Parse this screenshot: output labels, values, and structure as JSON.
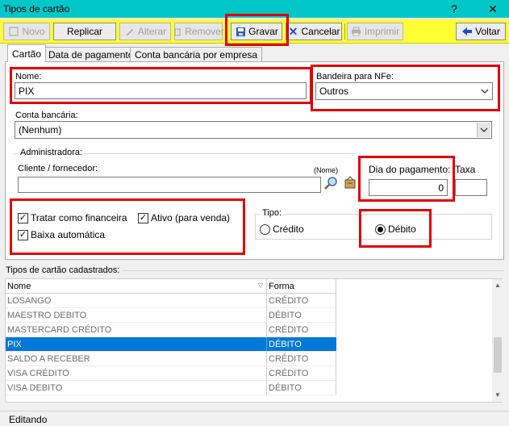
{
  "window": {
    "title": "Tipos de cartão",
    "help": "?",
    "close": "✕"
  },
  "toolbar": {
    "novo": "Novo",
    "replicar": "Replicar",
    "alterar": "Alterar",
    "remover": "Remover",
    "gravar": "Gravar",
    "cancelar": "Cancelar",
    "imprimir": "Imprimir",
    "voltar": "Voltar"
  },
  "tabs": [
    "Cartão",
    "Data de pagamento",
    "Conta bancária por empresa"
  ],
  "form": {
    "nome_label": "Nome:",
    "nome_value": "PIX",
    "bandeira_label": "Bandeira para NFe:",
    "bandeira_value": "Outros",
    "conta_label": "Conta bancária:",
    "conta_value": "(Nenhum)",
    "administradora_title": "Administradora:",
    "cliente_label": "Cliente / fornecedor:",
    "cliente_value": "",
    "nome_hint": "(Nome)",
    "dia_label": "Dia do pagamento:",
    "dia_value": "0",
    "taxa_label": "Taxa",
    "taxa_value": "",
    "tratar_label": "Tratar como financeira",
    "ativo_label": "Ativo (para venda)",
    "baixa_label": "Baixa automática",
    "tipo_title": "Tipo:",
    "credito_label": "Crédito",
    "debito_label": "Débito"
  },
  "list": {
    "section_title": "Tipos de cartão cadastrados:",
    "col_nome": "Nome",
    "col_forma": "Forma",
    "rows": [
      {
        "nome": "LOSANGO",
        "forma": "CRÉDITO"
      },
      {
        "nome": "MAESTRO DEBITO",
        "forma": "DÉBITO"
      },
      {
        "nome": "MASTERCARD CRÉDITO",
        "forma": "CRÉDITO"
      },
      {
        "nome": "PIX",
        "forma": "DÉBITO"
      },
      {
        "nome": "SALDO A RECEBER",
        "forma": "CRÉDITO"
      },
      {
        "nome": "VISA CRÉDITO",
        "forma": "CRÉDITO"
      },
      {
        "nome": "VISA DEBITO",
        "forma": "DÉBITO"
      }
    ]
  },
  "status": {
    "text": "Editando"
  },
  "colors": {
    "titlebar": "#00c8c8",
    "toolbar": "#ffff33",
    "selection": "#0078d7",
    "highlight": "#e00000"
  }
}
